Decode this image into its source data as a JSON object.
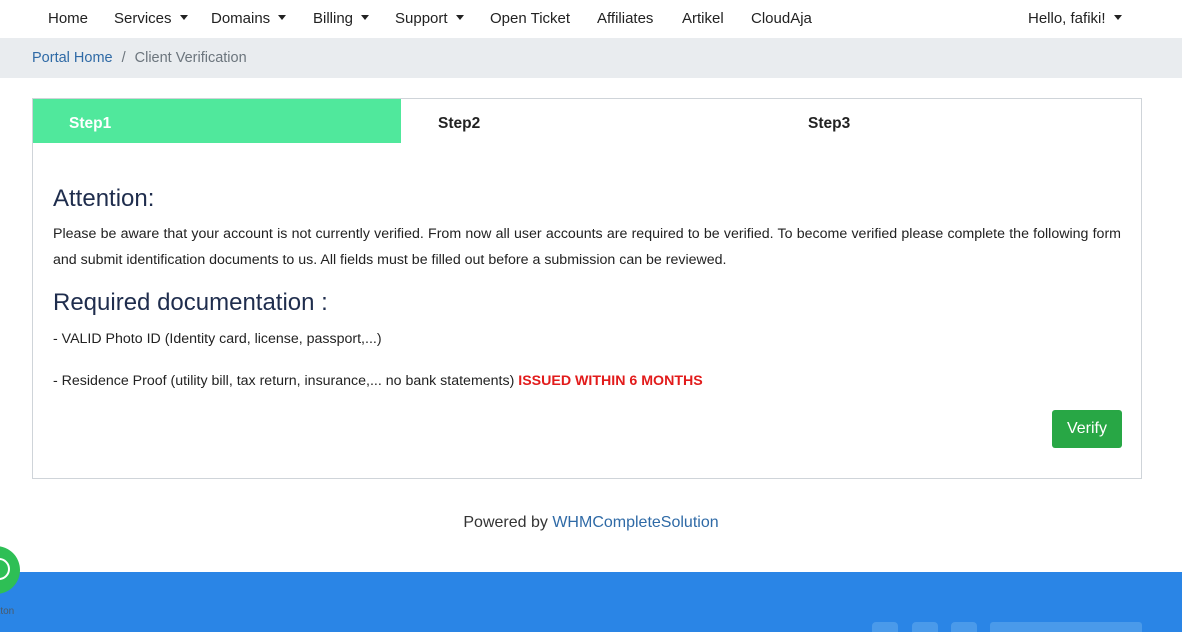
{
  "nav": {
    "home": "Home",
    "services": "Services",
    "domains": "Domains",
    "billing": "Billing",
    "support": "Support",
    "open_ticket": "Open Ticket",
    "affiliates": "Affiliates",
    "artikel": "Artikel",
    "cloudaja": "CloudAja",
    "account": "Hello, fafiki!"
  },
  "breadcrumb": {
    "home": "Portal Home",
    "separator": "/",
    "current": "Client Verification"
  },
  "steps": [
    "Step1",
    "Step2",
    "Step3"
  ],
  "active_step_color": "#50e89c",
  "content": {
    "attention_title": "Attention:",
    "attention_text": "Please be aware that your account is not currently verified. From now all user accounts are required to be verified. To become verified please complete the following form and submit identification documents to us. All fields must be filled out before a submission can be reviewed.",
    "required_title": "Required documentation :",
    "req1": "- VALID Photo ID (Identity card, license, passport,...)",
    "req2": "- Residence Proof (utility bill, tax return, insurance,... no bank statements)",
    "req2_highlight": "ISSUED WITHIN 6 MONTHS",
    "verify_button": "Verify"
  },
  "footer": {
    "powered_by": "Powered by",
    "powered_link": "WHMCompleteSolution"
  },
  "whatsapp": {
    "label": "utton"
  },
  "colors": {
    "footer_bg": "#2a85e6",
    "verify_btn": "#28a745",
    "highlight_red": "#e21b1b",
    "link_blue": "#2f6aa6"
  }
}
